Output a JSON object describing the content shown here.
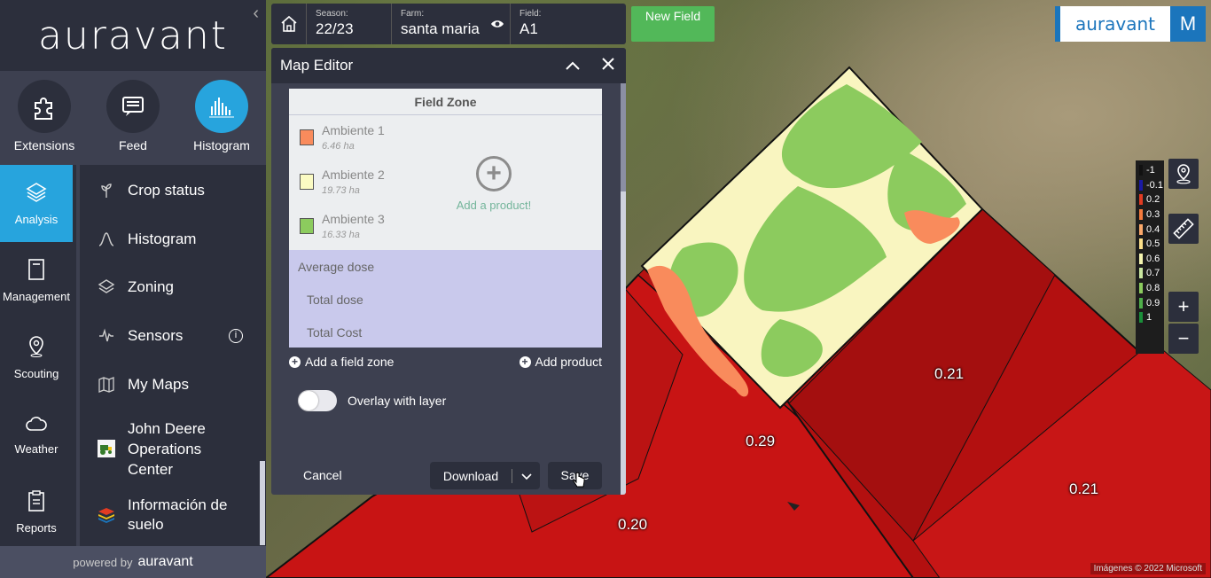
{
  "brand": {
    "name": "auravant",
    "powered_prefix": "powered by",
    "powered_name": "auravant"
  },
  "top_tools": [
    {
      "label": "Extensions",
      "icon": "puzzle-icon"
    },
    {
      "label": "Feed",
      "icon": "chat-icon"
    },
    {
      "label": "Histogram",
      "icon": "histogram-icon",
      "active": true
    }
  ],
  "rail": [
    {
      "label": "Analysis",
      "icon": "layers-icon",
      "active": true
    },
    {
      "label": "Management",
      "icon": "notebook-icon"
    },
    {
      "label": "Scouting",
      "icon": "pin-icon"
    },
    {
      "label": "Weather",
      "icon": "cloud-icon"
    },
    {
      "label": "Reports",
      "icon": "clipboard-icon"
    }
  ],
  "menu": [
    {
      "label": "Crop status",
      "icon": "plant-icon"
    },
    {
      "label": "Histogram",
      "icon": "curve-icon"
    },
    {
      "label": "Zoning",
      "icon": "stack-icon"
    },
    {
      "label": "Sensors",
      "icon": "signal-icon",
      "info": "i"
    },
    {
      "label": "My Maps",
      "icon": "map-icon"
    },
    {
      "label": "John Deere Operations Center",
      "icon": "tractor-icon"
    },
    {
      "label": "Información de suelo",
      "icon": "soil-layers-icon"
    }
  ],
  "topbar": {
    "season_label": "Season:",
    "season": "22/23",
    "farm_label": "Farm:",
    "farm": "santa maria",
    "field_label": "Field:",
    "field": "A1",
    "new_field": "New Field"
  },
  "user_initial": "M",
  "editor": {
    "title": "Map Editor",
    "table_header": "Field Zone",
    "zones": [
      {
        "name": "Ambiente 1",
        "area": "6.46 ha",
        "color": "#f98b5c"
      },
      {
        "name": "Ambiente 2",
        "area": "19.73 ha",
        "color": "#fbfbc3"
      },
      {
        "name": "Ambiente 3",
        "area": "16.33 ha",
        "color": "#8ccb5e"
      }
    ],
    "add_product_hint": "Add a product!",
    "average_dose": "Average dose",
    "total_dose": "Total dose",
    "total_cost": "Total Cost",
    "add_field_zone": "Add a field zone",
    "add_product": "Add product",
    "overlay_label": "Overlay with layer",
    "overlay_on": false,
    "cancel": "Cancel",
    "download": "Download",
    "save": "Save"
  },
  "legend": [
    {
      "label": "-1",
      "color": "#111111"
    },
    {
      "label": "-0.1",
      "color": "#1a1aa6"
    },
    {
      "label": "0.2",
      "color": "#e23b22"
    },
    {
      "label": "0.3",
      "color": "#f47a3c"
    },
    {
      "label": "0.4",
      "color": "#fba86a"
    },
    {
      "label": "0.5",
      "color": "#fce08a"
    },
    {
      "label": "0.6",
      "color": "#f5f5b0"
    },
    {
      "label": "0.7",
      "color": "#c9e6a0"
    },
    {
      "label": "0.8",
      "color": "#8ccb5e"
    },
    {
      "label": "0.9",
      "color": "#4fae4a"
    },
    {
      "label": "1",
      "color": "#1a8f3a"
    }
  ],
  "map_labels": [
    "0.21",
    "0.29",
    "0.21",
    "0.20"
  ],
  "attribution": "Imágenes © 2022 Microsoft"
}
